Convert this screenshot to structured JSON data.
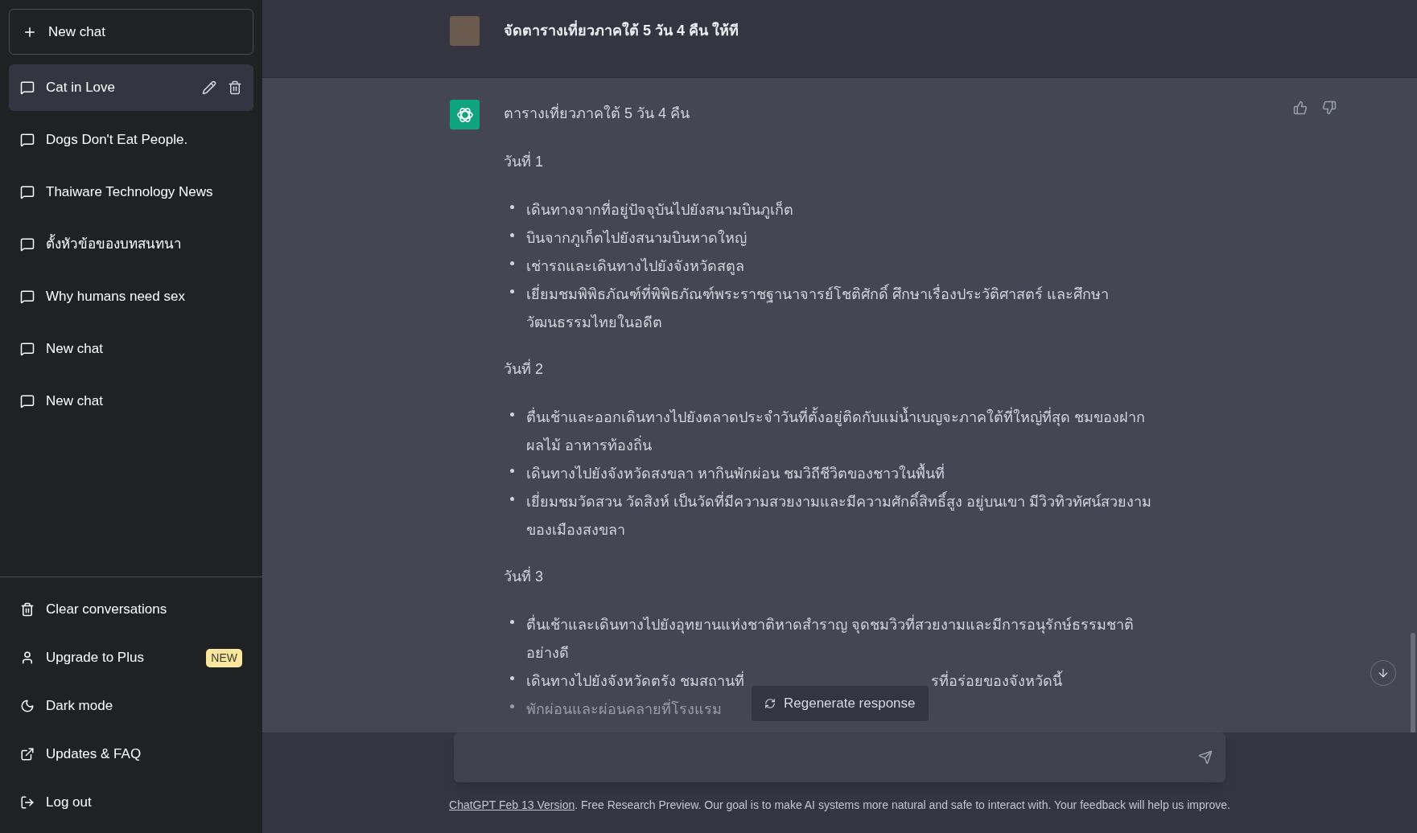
{
  "sidebar": {
    "new_chat_button": "New chat",
    "conversations": [
      {
        "title": "Cat in Love",
        "selected": true
      },
      {
        "title": "Dogs Don't Eat People.",
        "selected": false
      },
      {
        "title": "Thaiware Technology News",
        "selected": false
      },
      {
        "title": "ตั้งหัวข้อของบทสนทนา",
        "selected": false
      },
      {
        "title": "Why humans need sex",
        "selected": false
      },
      {
        "title": "New chat",
        "selected": false
      },
      {
        "title": "New chat",
        "selected": false
      }
    ],
    "menu": [
      {
        "kind": "clear",
        "label": "Clear conversations"
      },
      {
        "kind": "upgrade",
        "label": "Upgrade to Plus",
        "badge": "NEW"
      },
      {
        "kind": "theme",
        "label": "Dark mode"
      },
      {
        "kind": "updates",
        "label": "Updates & FAQ"
      },
      {
        "kind": "logout",
        "label": "Log out"
      }
    ]
  },
  "chat": {
    "user_message": "จัดตารางเที่ยวภาคใต้ 5 วัน 4 คืน ให้ที",
    "assistant_message": {
      "title": "ตารางเที่ยวภาคใต้ 5 วัน 4 คืน",
      "days": [
        {
          "heading": "วันที่ 1",
          "items": [
            {
              "text": "เดินทางจากที่อยู่ปัจจุบันไปยังสนามบินภูเก็ต",
              "faded": false
            },
            {
              "text": "บินจากภูเก็ตไปยังสนามบินหาดใหญ่",
              "faded": false
            },
            {
              "text": "เช่ารถและเดินทางไปยังจังหวัดสตูล",
              "faded": false
            },
            {
              "text": "เยี่ยมชมพิพิธภัณฑ์ที่พิพิธภัณฑ์พระราชฐานาจารย์โชติศักดิ์ ศึกษาเรื่องประวัติศาสตร์ และศึกษาวัฒนธรรมไทยในอดีต",
              "faded": false
            }
          ]
        },
        {
          "heading": "วันที่ 2",
          "items": [
            {
              "text": "ตื่นเช้าและออกเดินทางไปยังตลาดประจำวันที่ตั้งอยู่ติดกับแม่น้ำเบญจะภาคใต้ที่ใหญ่ที่สุด ชมของฝาก ผลไม้ อาหารท้องถิ่น",
              "faded": false
            },
            {
              "text": "เดินทางไปยังจังหวัดสงขลา หากินพักผ่อน ชมวิถีชีวิตของชาวในพื้นที่",
              "faded": false
            },
            {
              "text": "เยี่ยมชมวัดสวน วัดสิงห์ เป็นวัดที่มีความสวยงามและมีความศักดิ์สิทธิ์สูง อยู่บนเขา มีวิวทิวทัศน์สวยงามของเมืองสงขลา",
              "faded": false
            }
          ]
        },
        {
          "heading": "วันที่ 3",
          "items": [
            {
              "text": "ตื่นเช้าและเดินทางไปยังอุทยานแห่งชาติหาดสำราญ จุดชมวิวที่สวยงามและมีการอนุรักษ์ธรรมชาติอย่างดี",
              "faded": false
            },
            {
              "text": "เดินทางไปยังจังหวัดตรัง ชมสถานที่",
              "tail": "รที่อร่อยของจังหวัดนี้",
              "faded": false
            },
            {
              "text": "พักผ่อนและผ่อนคลายที่โรงแรม",
              "faded": true
            }
          ]
        }
      ]
    },
    "regenerate_button": "Regenerate response",
    "footer": {
      "link": "ChatGPT Feb 13 Version",
      "text": ". Free Research Preview. Our goal is to make AI systems more natural and safe to interact with. Your feedback will help us improve."
    }
  }
}
